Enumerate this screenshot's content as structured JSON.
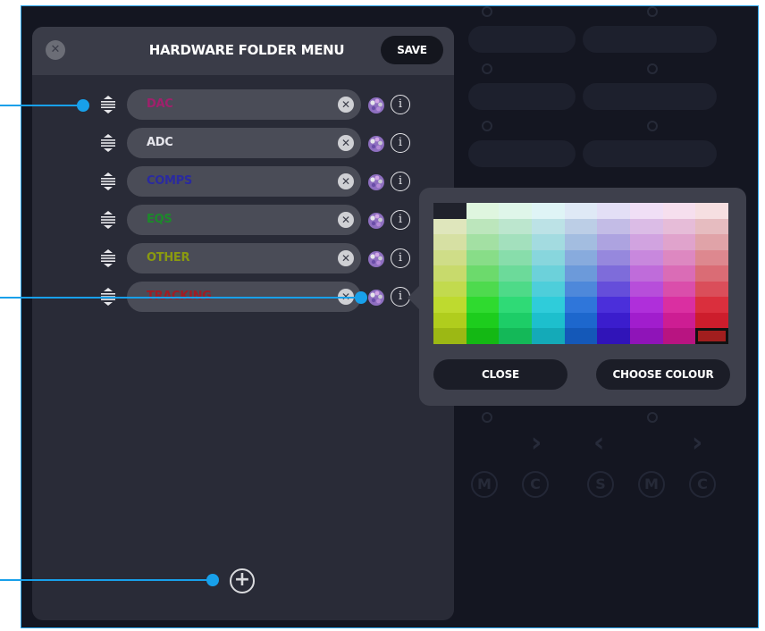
{
  "panel": {
    "title": "HARDWARE FOLDER MENU",
    "save_label": "SAVE",
    "close_icon": "close-icon",
    "add_icon": "plus-circle-icon"
  },
  "folders": [
    {
      "label": "DAC",
      "color": "#a0206c"
    },
    {
      "label": "ADC",
      "color": "#e6e6ec"
    },
    {
      "label": "COMPS",
      "color": "#2a2aa0"
    },
    {
      "label": "EQS",
      "color": "#1c8a2a"
    },
    {
      "label": "OTHER",
      "color": "#8a9a10"
    },
    {
      "label": "TRACKING",
      "color": "#a01c24"
    }
  ],
  "row_icons": {
    "drag": "drag-handle-icon",
    "clear": "clear-icon",
    "palette": "palette-icon",
    "info": "info-icon"
  },
  "color_picker": {
    "close_label": "CLOSE",
    "choose_label": "CHOOSE COLOUR",
    "selected": "#a11e1e"
  },
  "colors": {
    "accent": "#18a0ea",
    "background": "#141621",
    "panel": "#292b37",
    "header": "#3a3c48"
  }
}
